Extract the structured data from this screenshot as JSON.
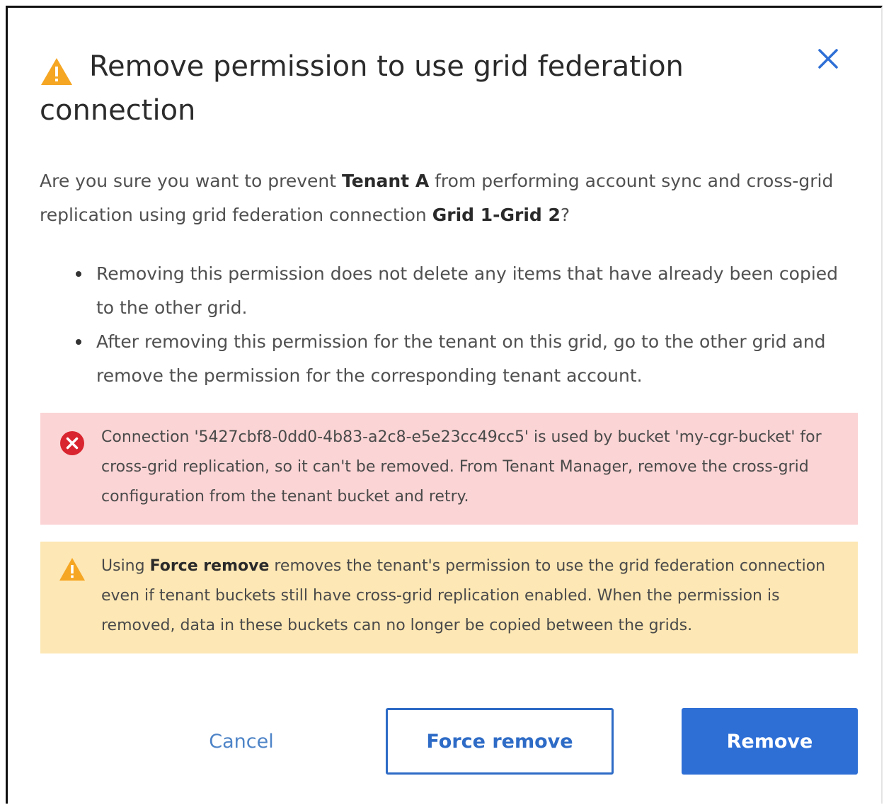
{
  "dialog": {
    "title": "Remove permission to use grid federation connection",
    "icons": {
      "title": "warning-triangle-icon",
      "close": "close-icon",
      "error": "error-circle-x-icon",
      "warning": "warning-triangle-icon"
    },
    "confirm": {
      "prefix": "Are you sure you want to prevent ",
      "tenant": "Tenant A",
      "middle": " from performing account sync and cross-grid replication using grid federation connection ",
      "connection": "Grid 1-Grid 2",
      "suffix": "?"
    },
    "bullets": [
      "Removing this permission does not delete any items that have already been copied to the other grid.",
      "After removing this permission for the tenant on this grid, go to the other grid and remove the permission for the corresponding tenant account."
    ],
    "error_alert": "Connection '5427cbf8-0dd0-4b83-a2c8-e5e23cc49cc5' is used by bucket 'my-cgr-bucket' for cross-grid replication, so it can't be removed. From Tenant Manager, remove the cross-grid configuration from the tenant bucket and retry.",
    "warning_alert": {
      "prefix": "Using ",
      "emphasis": "Force remove",
      "suffix": " removes the tenant's permission to use the grid federation connection even if tenant buckets still have cross-grid replication enabled. When the permission is removed, data in these buckets can no longer be copied between the grids."
    },
    "buttons": {
      "cancel": "Cancel",
      "force_remove": "Force remove",
      "remove": "Remove"
    }
  },
  "colors": {
    "primary": "#2e6fd6",
    "error_bg": "#fbd4d5",
    "error_icon": "#d9252f",
    "warning_bg": "#fde7b4",
    "warning_icon": "#f5a623"
  }
}
